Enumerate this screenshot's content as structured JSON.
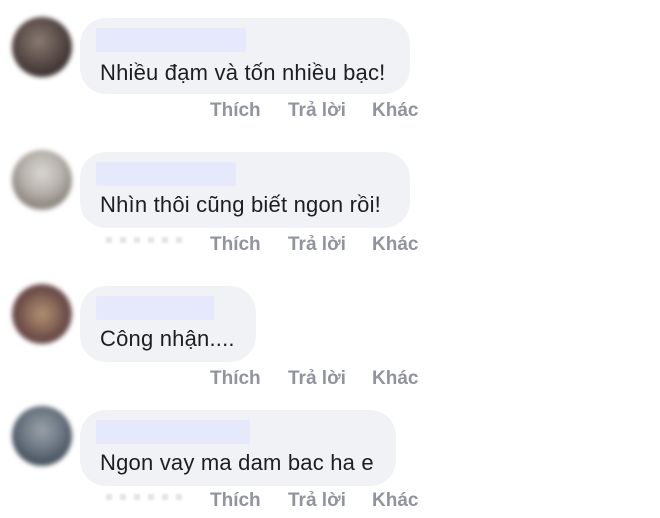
{
  "comments": [
    {
      "text": "Nhiều đạm và tốn nhiều bạc!",
      "actions": {
        "like": "Thích",
        "reply": "Trả lời",
        "more": "Khác"
      }
    },
    {
      "text": "Nhìn thôi cũng biết ngon rồi!",
      "actions": {
        "like": "Thích",
        "reply": "Trả lời",
        "more": "Khác"
      }
    },
    {
      "text": "Công nhận....",
      "actions": {
        "like": "Thích",
        "reply": "Trả lời",
        "more": "Khác"
      }
    },
    {
      "text": "Ngon vay ma dam bac ha e",
      "actions": {
        "like": "Thích",
        "reply": "Trả lời",
        "more": "Khác"
      }
    }
  ],
  "colors": {
    "bubble": "#f0f2f5",
    "redaction": "#e6e8fb",
    "action_text": "#90949c",
    "body_text": "#1c1e21"
  }
}
